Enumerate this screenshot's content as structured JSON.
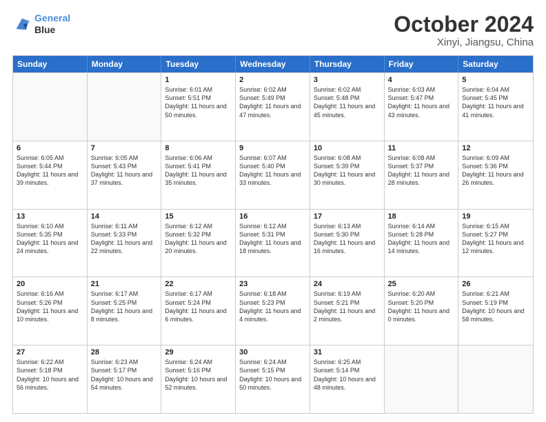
{
  "logo": {
    "line1": "General",
    "line2": "Blue"
  },
  "title": {
    "month": "October 2024",
    "location": "Xinyi, Jiangsu, China"
  },
  "header_days": [
    "Sunday",
    "Monday",
    "Tuesday",
    "Wednesday",
    "Thursday",
    "Friday",
    "Saturday"
  ],
  "weeks": [
    [
      {
        "day": "",
        "sunrise": "",
        "sunset": "",
        "daylight": ""
      },
      {
        "day": "",
        "sunrise": "",
        "sunset": "",
        "daylight": ""
      },
      {
        "day": "1",
        "sunrise": "Sunrise: 6:01 AM",
        "sunset": "Sunset: 5:51 PM",
        "daylight": "Daylight: 11 hours and 50 minutes."
      },
      {
        "day": "2",
        "sunrise": "Sunrise: 6:02 AM",
        "sunset": "Sunset: 5:49 PM",
        "daylight": "Daylight: 11 hours and 47 minutes."
      },
      {
        "day": "3",
        "sunrise": "Sunrise: 6:02 AM",
        "sunset": "Sunset: 5:48 PM",
        "daylight": "Daylight: 11 hours and 45 minutes."
      },
      {
        "day": "4",
        "sunrise": "Sunrise: 6:03 AM",
        "sunset": "Sunset: 5:47 PM",
        "daylight": "Daylight: 11 hours and 43 minutes."
      },
      {
        "day": "5",
        "sunrise": "Sunrise: 6:04 AM",
        "sunset": "Sunset: 5:45 PM",
        "daylight": "Daylight: 11 hours and 41 minutes."
      }
    ],
    [
      {
        "day": "6",
        "sunrise": "Sunrise: 6:05 AM",
        "sunset": "Sunset: 5:44 PM",
        "daylight": "Daylight: 11 hours and 39 minutes."
      },
      {
        "day": "7",
        "sunrise": "Sunrise: 6:05 AM",
        "sunset": "Sunset: 5:43 PM",
        "daylight": "Daylight: 11 hours and 37 minutes."
      },
      {
        "day": "8",
        "sunrise": "Sunrise: 6:06 AM",
        "sunset": "Sunset: 5:41 PM",
        "daylight": "Daylight: 11 hours and 35 minutes."
      },
      {
        "day": "9",
        "sunrise": "Sunrise: 6:07 AM",
        "sunset": "Sunset: 5:40 PM",
        "daylight": "Daylight: 11 hours and 33 minutes."
      },
      {
        "day": "10",
        "sunrise": "Sunrise: 6:08 AM",
        "sunset": "Sunset: 5:39 PM",
        "daylight": "Daylight: 11 hours and 30 minutes."
      },
      {
        "day": "11",
        "sunrise": "Sunrise: 6:08 AM",
        "sunset": "Sunset: 5:37 PM",
        "daylight": "Daylight: 11 hours and 28 minutes."
      },
      {
        "day": "12",
        "sunrise": "Sunrise: 6:09 AM",
        "sunset": "Sunset: 5:36 PM",
        "daylight": "Daylight: 11 hours and 26 minutes."
      }
    ],
    [
      {
        "day": "13",
        "sunrise": "Sunrise: 6:10 AM",
        "sunset": "Sunset: 5:35 PM",
        "daylight": "Daylight: 11 hours and 24 minutes."
      },
      {
        "day": "14",
        "sunrise": "Sunrise: 6:11 AM",
        "sunset": "Sunset: 5:33 PM",
        "daylight": "Daylight: 11 hours and 22 minutes."
      },
      {
        "day": "15",
        "sunrise": "Sunrise: 6:12 AM",
        "sunset": "Sunset: 5:32 PM",
        "daylight": "Daylight: 11 hours and 20 minutes."
      },
      {
        "day": "16",
        "sunrise": "Sunrise: 6:12 AM",
        "sunset": "Sunset: 5:31 PM",
        "daylight": "Daylight: 11 hours and 18 minutes."
      },
      {
        "day": "17",
        "sunrise": "Sunrise: 6:13 AM",
        "sunset": "Sunset: 5:30 PM",
        "daylight": "Daylight: 11 hours and 16 minutes."
      },
      {
        "day": "18",
        "sunrise": "Sunrise: 6:14 AM",
        "sunset": "Sunset: 5:28 PM",
        "daylight": "Daylight: 11 hours and 14 minutes."
      },
      {
        "day": "19",
        "sunrise": "Sunrise: 6:15 AM",
        "sunset": "Sunset: 5:27 PM",
        "daylight": "Daylight: 11 hours and 12 minutes."
      }
    ],
    [
      {
        "day": "20",
        "sunrise": "Sunrise: 6:16 AM",
        "sunset": "Sunset: 5:26 PM",
        "daylight": "Daylight: 11 hours and 10 minutes."
      },
      {
        "day": "21",
        "sunrise": "Sunrise: 6:17 AM",
        "sunset": "Sunset: 5:25 PM",
        "daylight": "Daylight: 11 hours and 8 minutes."
      },
      {
        "day": "22",
        "sunrise": "Sunrise: 6:17 AM",
        "sunset": "Sunset: 5:24 PM",
        "daylight": "Daylight: 11 hours and 6 minutes."
      },
      {
        "day": "23",
        "sunrise": "Sunrise: 6:18 AM",
        "sunset": "Sunset: 5:23 PM",
        "daylight": "Daylight: 11 hours and 4 minutes."
      },
      {
        "day": "24",
        "sunrise": "Sunrise: 6:19 AM",
        "sunset": "Sunset: 5:21 PM",
        "daylight": "Daylight: 11 hours and 2 minutes."
      },
      {
        "day": "25",
        "sunrise": "Sunrise: 6:20 AM",
        "sunset": "Sunset: 5:20 PM",
        "daylight": "Daylight: 11 hours and 0 minutes."
      },
      {
        "day": "26",
        "sunrise": "Sunrise: 6:21 AM",
        "sunset": "Sunset: 5:19 PM",
        "daylight": "Daylight: 10 hours and 58 minutes."
      }
    ],
    [
      {
        "day": "27",
        "sunrise": "Sunrise: 6:22 AM",
        "sunset": "Sunset: 5:18 PM",
        "daylight": "Daylight: 10 hours and 56 minutes."
      },
      {
        "day": "28",
        "sunrise": "Sunrise: 6:23 AM",
        "sunset": "Sunset: 5:17 PM",
        "daylight": "Daylight: 10 hours and 54 minutes."
      },
      {
        "day": "29",
        "sunrise": "Sunrise: 6:24 AM",
        "sunset": "Sunset: 5:16 PM",
        "daylight": "Daylight: 10 hours and 52 minutes."
      },
      {
        "day": "30",
        "sunrise": "Sunrise: 6:24 AM",
        "sunset": "Sunset: 5:15 PM",
        "daylight": "Daylight: 10 hours and 50 minutes."
      },
      {
        "day": "31",
        "sunrise": "Sunrise: 6:25 AM",
        "sunset": "Sunset: 5:14 PM",
        "daylight": "Daylight: 10 hours and 48 minutes."
      },
      {
        "day": "",
        "sunrise": "",
        "sunset": "",
        "daylight": ""
      },
      {
        "day": "",
        "sunrise": "",
        "sunset": "",
        "daylight": ""
      }
    ]
  ]
}
